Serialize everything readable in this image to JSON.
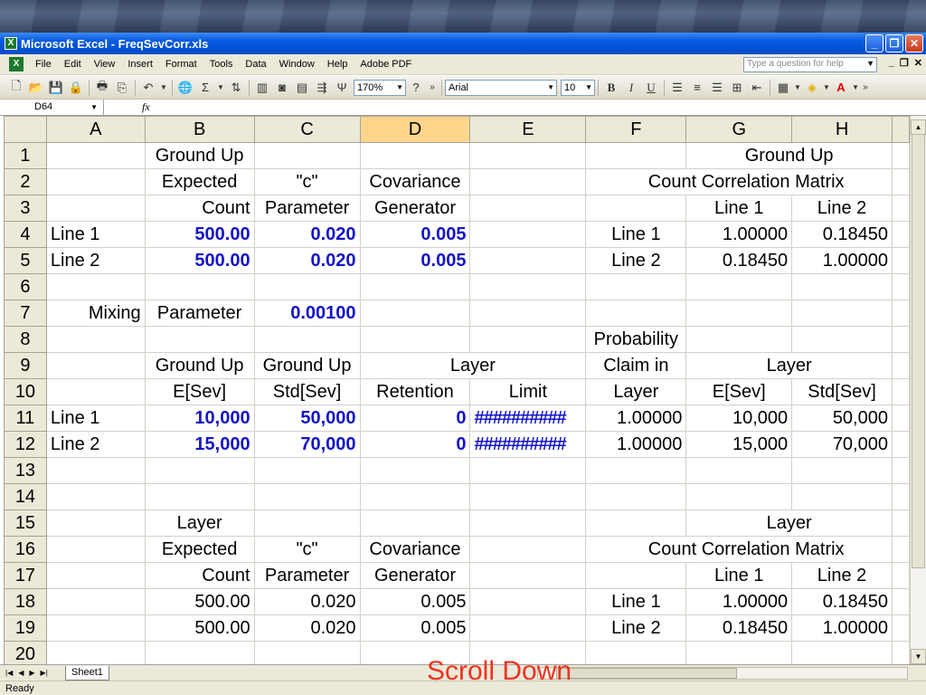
{
  "window": {
    "title": "Microsoft Excel - FreqSevCorr.xls",
    "minimize": "_",
    "restore": "❐",
    "close": "✕"
  },
  "menu": {
    "items": [
      "File",
      "Edit",
      "View",
      "Insert",
      "Format",
      "Tools",
      "Data",
      "Window",
      "Help",
      "Adobe PDF"
    ],
    "help_placeholder": "Type a question for help",
    "doc_min": "_",
    "doc_restore": "❐",
    "doc_close": "✕"
  },
  "toolbar": {
    "zoom": "170%",
    "font": "Arial",
    "font_size": "10"
  },
  "formula_bar": {
    "name_box": "D64",
    "fx": "fx",
    "content": ""
  },
  "columns": [
    "A",
    "B",
    "C",
    "D",
    "E",
    "F",
    "G",
    "H"
  ],
  "selected_column": "D",
  "rows": [
    {
      "n": "1",
      "A": "",
      "B": "Ground Up",
      "C": "",
      "D": "",
      "E": "",
      "FGH": "Ground Up"
    },
    {
      "n": "2",
      "A": "",
      "B": "Expected",
      "C": "\"c\"",
      "D": "Covariance",
      "E": "",
      "FGH": "Count Correlation Matrix"
    },
    {
      "n": "3",
      "A": "",
      "B": "Count",
      "C": "Parameter",
      "D": "Generator",
      "E": "",
      "F": "",
      "G": "Line 1",
      "H": "Line 2"
    },
    {
      "n": "4",
      "A": "Line 1",
      "B": "500.00",
      "C": "0.020",
      "D": "0.005",
      "E": "",
      "F": "Line 1",
      "G": "1.00000",
      "H": "0.18450"
    },
    {
      "n": "5",
      "A": "Line 2",
      "B": "500.00",
      "C": "0.020",
      "D": "0.005",
      "E": "",
      "F": "Line 2",
      "G": "0.18450",
      "H": "1.00000"
    },
    {
      "n": "6"
    },
    {
      "n": "7",
      "A": "Mixing",
      "B": "Parameter",
      "C": "0.00100"
    },
    {
      "n": "8",
      "F": "Probability"
    },
    {
      "n": "9",
      "B": "Ground Up",
      "C": "Ground Up",
      "DE": "Layer",
      "F": "Claim in",
      "GH": "Layer"
    },
    {
      "n": "10",
      "B": "E[Sev]",
      "C": "Std[Sev]",
      "D": "Retention",
      "E": "Limit",
      "F": "Layer",
      "G": "E[Sev]",
      "H": "Std[Sev]"
    },
    {
      "n": "11",
      "A": "Line 1",
      "B": "10,000",
      "C": "50,000",
      "D": "0",
      "E": "##########",
      "F": "1.00000",
      "G": "10,000",
      "H": "50,000"
    },
    {
      "n": "12",
      "A": "Line 2",
      "B": "15,000",
      "C": "70,000",
      "D": "0",
      "E": "##########",
      "F": "1.00000",
      "G": "15,000",
      "H": "70,000"
    },
    {
      "n": "13"
    },
    {
      "n": "14"
    },
    {
      "n": "15",
      "B": "Layer",
      "FGH": "Layer"
    },
    {
      "n": "16",
      "B": "Expected",
      "C": "\"c\"",
      "D": "Covariance",
      "FGH": "Count Correlation Matrix"
    },
    {
      "n": "17",
      "B": "Count",
      "C": "Parameter",
      "D": "Generator",
      "G": "Line 1",
      "H": "Line 2"
    },
    {
      "n": "18",
      "B": "500.00",
      "C": "0.020",
      "D": "0.005",
      "F": "Line 1",
      "G": "1.00000",
      "H": "0.18450"
    },
    {
      "n": "19",
      "B": "500.00",
      "C": "0.020",
      "D": "0.005",
      "F": "Line 2",
      "G": "0.18450",
      "H": "1.00000"
    },
    {
      "n": "20"
    }
  ],
  "sheet_tab": "Sheet1",
  "overlay_text": "Scroll Down",
  "status": "Ready"
}
